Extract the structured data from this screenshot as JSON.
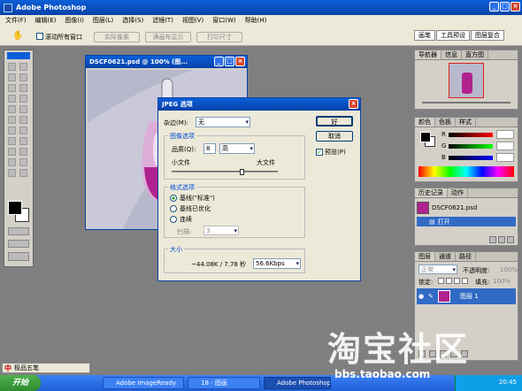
{
  "app": {
    "title": "Adobe Photoshop"
  },
  "menu": [
    "文件(F)",
    "编辑(E)",
    "图像(I)",
    "图层(L)",
    "选择(S)",
    "滤镜(T)",
    "视图(V)",
    "窗口(W)",
    "帮助(H)"
  ],
  "options": {
    "scroll_all": "滚动所有窗口",
    "actual_pixels": "实际像素",
    "fit_screen": "满画布显示",
    "print_size": "打印尺寸",
    "tabs": [
      "画笔",
      "工具预设",
      "图层复合"
    ]
  },
  "doc": {
    "title": "DSCF0621.psd @ 100% (图..."
  },
  "dialog": {
    "title": "JPEG 选项",
    "matte_label": "杂边(M):",
    "matte_value": "无",
    "image_options": "图像选项",
    "quality_label": "品质(Q):",
    "quality_value": "8",
    "quality_level": "高",
    "small_file": "小文件",
    "large_file": "大文件",
    "quality_fraction": 0.67,
    "format_options": "格式选项",
    "formats": [
      "基线(\"标准\")",
      "基线已优化",
      "连续"
    ],
    "scans_label": "扫描:",
    "scans_value": "3",
    "size": "大小",
    "size_value": "~44.08K / 7.78 秒",
    "speed": "56.6Kbps",
    "ok": "好",
    "cancel": "取消",
    "preview": "预览(P)"
  },
  "navigator": {
    "tabs": [
      "导航器",
      "信息",
      "直方图"
    ]
  },
  "color": {
    "tabs": [
      "颜色",
      "色板",
      "样式"
    ],
    "channels": [
      "R",
      "G",
      "B"
    ]
  },
  "history": {
    "tabs": [
      "历史记录",
      "动作"
    ],
    "doc": "DSCF0621.psd",
    "step": "打开"
  },
  "layers": {
    "tabs": [
      "图层",
      "通道",
      "路径"
    ],
    "mode": "正常",
    "opacity_label": "不透明度:",
    "opacity_value": "100%",
    "lock_label": "锁定:",
    "fill_label": "填充:",
    "fill_value": "100%",
    "layer_name": "图层 1"
  },
  "watermark": {
    "logo": "淘宝社区",
    "url": "bbs.taobao.com"
  },
  "taskbar": {
    "start": "开始",
    "ime": "极品五笔",
    "items": [
      "Adobe ImageReady",
      "18 - 图画",
      "Adobe Photoshop"
    ],
    "time": "20:45"
  }
}
